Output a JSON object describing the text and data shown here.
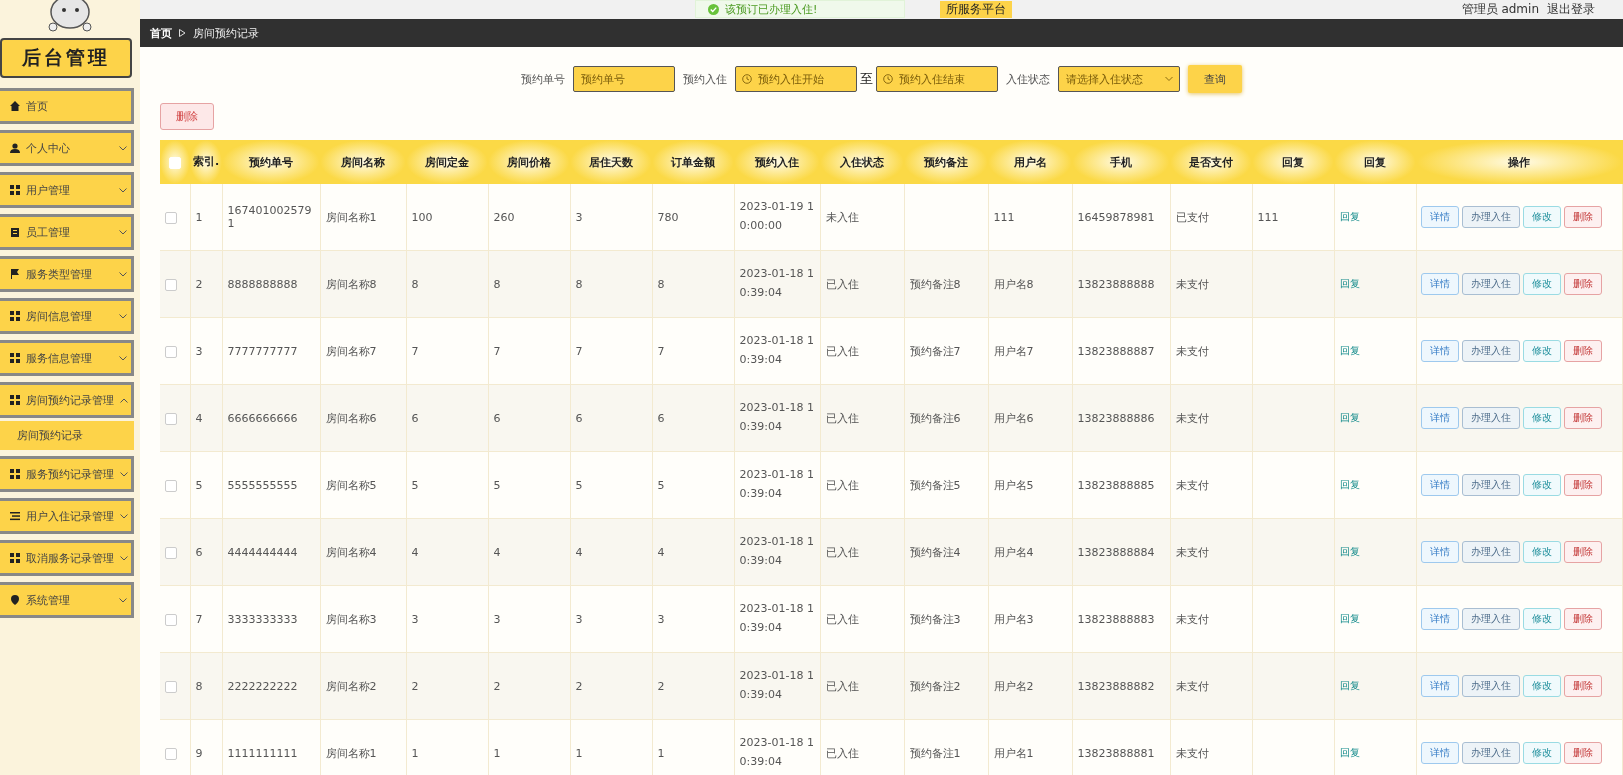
{
  "header": {
    "title": "所服务平台",
    "user": "管理员 admin",
    "logout": "退出登录"
  },
  "toast": {
    "message": "该预订已办理入住!"
  },
  "sidebar": {
    "title": "后台管理",
    "items": [
      {
        "label": "首页",
        "kind": "home"
      },
      {
        "label": "个人中心",
        "kind": "user",
        "expanded": false
      },
      {
        "label": "用户管理",
        "kind": "grid",
        "expanded": false
      },
      {
        "label": "员工管理",
        "kind": "clipboard",
        "expanded": false
      },
      {
        "label": "服务类型管理",
        "kind": "flag",
        "expanded": false
      },
      {
        "label": "房间信息管理",
        "kind": "grid",
        "expanded": false
      },
      {
        "label": "服务信息管理",
        "kind": "grid",
        "expanded": false
      },
      {
        "label": "房间预约记录管理",
        "kind": "grid",
        "expanded": true,
        "children": [
          {
            "label": "房间预约记录",
            "selected": true
          }
        ]
      },
      {
        "label": "服务预约记录管理",
        "kind": "grid",
        "expanded": false
      },
      {
        "label": "用户入住记录管理",
        "kind": "list",
        "expanded": false
      },
      {
        "label": "取消服务记录管理",
        "kind": "grid",
        "expanded": false
      },
      {
        "label": "系统管理",
        "kind": "pin",
        "expanded": false
      }
    ]
  },
  "breadcrumb": [
    "首页",
    "房间预约记录"
  ],
  "search": {
    "fields": [
      {
        "label": "预约单号",
        "placeholder": "预约单号",
        "kind": "text"
      },
      {
        "label": "预约入住",
        "placeholder": "预约入住开始",
        "kind": "date"
      },
      {
        "label": "至",
        "placeholder": "预约入住结束",
        "kind": "date"
      },
      {
        "label": "入住状态",
        "placeholder": "请选择入住状态",
        "kind": "select"
      }
    ],
    "button": "查询"
  },
  "delete_button": "删除",
  "table": {
    "all_checked": false,
    "columns": [
      "索引.",
      "预约单号",
      "房间名称",
      "房间定金",
      "房间价格",
      "居住天数",
      "订单金额",
      "预约入住",
      "入住状态",
      "预约备注",
      "用户名",
      "手机",
      "是否支付",
      "回复",
      "回复",
      "操作"
    ],
    "rows": [
      {
        "checked": false,
        "index": "1",
        "order_no": "1674010025791",
        "room": "房间名称1",
        "deposit": "100",
        "price": "260",
        "days": "3",
        "amount": "780",
        "checkin": "2023-01-19 10:00:00",
        "status": "未入住",
        "user": "111",
        "phone": "16459878981",
        "paid": "已支付",
        "reply": "111",
        "link": "回复",
        "actions": [
          {
            "label": "详情",
            "kind": "info"
          },
          {
            "label": "办理入住",
            "kind": "plain"
          },
          {
            "label": "修改",
            "kind": "edit"
          },
          {
            "label": "删除",
            "kind": "danger"
          }
        ]
      },
      {
        "checked": false,
        "index": "2",
        "order_no": "8888888888",
        "room": "房间名称8",
        "deposit": "8",
        "price": "8",
        "days": "8",
        "amount": "8",
        "checkin": "2023-01-18 10:39:04",
        "status": "已入住",
        "note": "预约备注8",
        "user": "用户名8",
        "phone": "13823888888",
        "paid": "未支付",
        "link": "回复",
        "actions": [
          {
            "label": "详情",
            "kind": "info"
          },
          {
            "label": "办理入住",
            "kind": "plain"
          },
          {
            "label": "修改",
            "kind": "edit"
          },
          {
            "label": "删除",
            "kind": "danger"
          }
        ]
      },
      {
        "checked": false,
        "index": "3",
        "order_no": "7777777777",
        "room": "房间名称7",
        "deposit": "7",
        "price": "7",
        "days": "7",
        "amount": "7",
        "checkin": "2023-01-18 10:39:04",
        "status": "已入住",
        "note": "预约备注7",
        "user": "用户名7",
        "phone": "13823888887",
        "paid": "未支付",
        "link": "回复",
        "actions": [
          {
            "label": "详情",
            "kind": "info"
          },
          {
            "label": "办理入住",
            "kind": "plain"
          },
          {
            "label": "修改",
            "kind": "edit"
          },
          {
            "label": "删除",
            "kind": "danger"
          }
        ]
      },
      {
        "checked": false,
        "index": "4",
        "order_no": "6666666666",
        "room": "房间名称6",
        "deposit": "6",
        "price": "6",
        "days": "6",
        "amount": "6",
        "checkin": "2023-01-18 10:39:04",
        "status": "已入住",
        "note": "预约备注6",
        "user": "用户名6",
        "phone": "13823888886",
        "paid": "未支付",
        "link": "回复",
        "actions": [
          {
            "label": "详情",
            "kind": "info"
          },
          {
            "label": "办理入住",
            "kind": "plain"
          },
          {
            "label": "修改",
            "kind": "edit"
          },
          {
            "label": "删除",
            "kind": "danger"
          }
        ]
      },
      {
        "checked": false,
        "index": "5",
        "order_no": "5555555555",
        "room": "房间名称5",
        "deposit": "5",
        "price": "5",
        "days": "5",
        "amount": "5",
        "checkin": "2023-01-18 10:39:04",
        "status": "已入住",
        "note": "预约备注5",
        "user": "用户名5",
        "phone": "13823888885",
        "paid": "未支付",
        "link": "回复",
        "actions": [
          {
            "label": "详情",
            "kind": "info"
          },
          {
            "label": "办理入住",
            "kind": "plain"
          },
          {
            "label": "修改",
            "kind": "edit"
          },
          {
            "label": "删除",
            "kind": "danger"
          }
        ]
      },
      {
        "checked": false,
        "index": "6",
        "order_no": "4444444444",
        "room": "房间名称4",
        "deposit": "4",
        "price": "4",
        "days": "4",
        "amount": "4",
        "checkin": "2023-01-18 10:39:04",
        "status": "已入住",
        "note": "预约备注4",
        "user": "用户名4",
        "phone": "13823888884",
        "paid": "未支付",
        "link": "回复",
        "actions": [
          {
            "label": "详情",
            "kind": "info"
          },
          {
            "label": "办理入住",
            "kind": "plain"
          },
          {
            "label": "修改",
            "kind": "edit"
          },
          {
            "label": "删除",
            "kind": "danger"
          }
        ]
      },
      {
        "checked": false,
        "index": "7",
        "order_no": "3333333333",
        "room": "房间名称3",
        "deposit": "3",
        "price": "3",
        "days": "3",
        "amount": "3",
        "checkin": "2023-01-18 10:39:04",
        "status": "已入住",
        "note": "预约备注3",
        "user": "用户名3",
        "phone": "13823888883",
        "paid": "未支付",
        "link": "回复",
        "actions": [
          {
            "label": "详情",
            "kind": "info"
          },
          {
            "label": "办理入住",
            "kind": "plain"
          },
          {
            "label": "修改",
            "kind": "edit"
          },
          {
            "label": "删除",
            "kind": "danger"
          }
        ]
      },
      {
        "checked": false,
        "index": "8",
        "order_no": "2222222222",
        "room": "房间名称2",
        "deposit": "2",
        "price": "2",
        "days": "2",
        "amount": "2",
        "checkin": "2023-01-18 10:39:04",
        "status": "已入住",
        "note": "预约备注2",
        "user": "用户名2",
        "phone": "13823888882",
        "paid": "未支付",
        "link": "回复",
        "actions": [
          {
            "label": "详情",
            "kind": "info"
          },
          {
            "label": "办理入住",
            "kind": "plain"
          },
          {
            "label": "修改",
            "kind": "edit"
          },
          {
            "label": "删除",
            "kind": "danger"
          }
        ]
      },
      {
        "checked": false,
        "index": "9",
        "order_no": "1111111111",
        "room": "房间名称1",
        "deposit": "1",
        "price": "1",
        "days": "1",
        "amount": "1",
        "checkin": "2023-01-18 10:39:04",
        "status": "已入住",
        "note": "预约备注1",
        "user": "用户名1",
        "phone": "13823888881",
        "paid": "未支付",
        "link": "回复",
        "actions": [
          {
            "label": "详情",
            "kind": "info"
          },
          {
            "label": "办理入住",
            "kind": "plain"
          },
          {
            "label": "修改",
            "kind": "edit"
          },
          {
            "label": "删除",
            "kind": "danger"
          }
        ]
      }
    ]
  }
}
